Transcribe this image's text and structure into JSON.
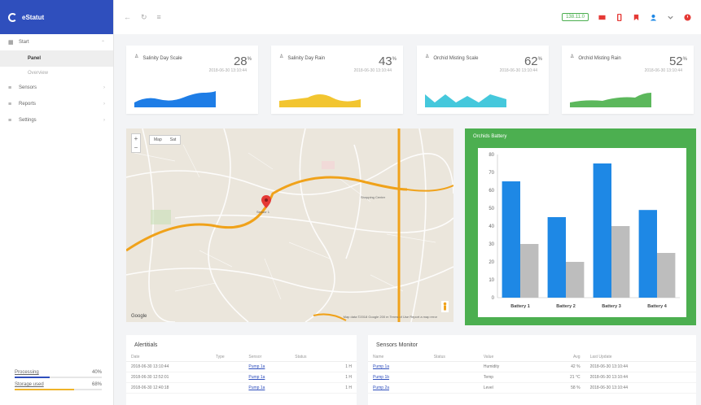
{
  "app": {
    "name": "eStatut"
  },
  "sidebar": {
    "items": [
      {
        "label": "Start",
        "icon": "grid-icon"
      },
      {
        "label": "Panel",
        "active": true
      },
      {
        "label": "Overview",
        "sub": true
      },
      {
        "label": "Sensors",
        "icon": "list-icon"
      },
      {
        "label": "Reports",
        "icon": "list-icon"
      },
      {
        "label": "Settings",
        "icon": "list-icon"
      }
    ],
    "stats": [
      {
        "label": "Processing",
        "value": "40%",
        "fraction": 0.4,
        "color": "#2f4fbd"
      },
      {
        "label": "Storage used",
        "value": "68%",
        "fraction": 0.68,
        "color": "#f0b429"
      }
    ]
  },
  "topbar": {
    "back": "←",
    "refresh": "↻",
    "menu": "≡",
    "badge": "138.11.0",
    "icons": [
      "mail-icon",
      "phone-icon",
      "bookmark-icon",
      "user-icon",
      "chevron-down-icon",
      "power-icon"
    ],
    "colors": {
      "accent": "#2f4fbd",
      "red": "#e53935"
    }
  },
  "kpis": [
    {
      "title": "Salinity Day Scale",
      "value": "28",
      "unit": "%",
      "sub": "2018-06-30 13:10:44",
      "color": "#1e7de6"
    },
    {
      "title": "Salinity Day Rain",
      "value": "43",
      "unit": "%",
      "sub": "2018-06-30 13:10:44",
      "color": "#f2c530"
    },
    {
      "title": "Orchid Misting Scale",
      "value": "62",
      "unit": "%",
      "sub": "2018-06-30 13:10:44",
      "color": "#45c8dc"
    },
    {
      "title": "Orchid Misting Rain",
      "value": "52",
      "unit": "%",
      "sub": "2018-06-30 13:10:44",
      "color": "#5cb85c"
    }
  ],
  "map": {
    "zoom_in": "+",
    "zoom_out": "−",
    "type_options": [
      "Map",
      "Sat"
    ],
    "credit": "Google",
    "legal": "Map data ©2018 Google  200 m  Terms of Use  Report a map error",
    "marker_label": "Sensor 1",
    "place_label": "Shopping Center"
  },
  "chart_panel": {
    "title": "Orchids Battery"
  },
  "chart_data": {
    "type": "bar",
    "categories": [
      "Battery 1",
      "Battery 2",
      "Battery 3",
      "Battery 4"
    ],
    "series": [
      {
        "values": [
          65,
          45,
          75,
          49
        ],
        "color": "#1e88e5"
      },
      {
        "values": [
          30,
          20,
          40,
          25
        ],
        "color": "#bdbdbd"
      }
    ],
    "ylim": [
      0,
      80
    ],
    "yticks": [
      0,
      10,
      20,
      30,
      40,
      50,
      60,
      70,
      80
    ],
    "grid": false
  },
  "alerts": {
    "title": "Alertitials",
    "columns": [
      "Date",
      "Type",
      "Sensor",
      "Status",
      ""
    ],
    "rows": [
      [
        "2018-06-30 13:10:44",
        "",
        "Pump 1a",
        "",
        "1 H"
      ],
      [
        "2018-06-30 12:52:01",
        "",
        "Pump 1a",
        "",
        "1 H"
      ],
      [
        "2018-06-30 12:40:18",
        "",
        "Pump 1a",
        "",
        "1 H"
      ]
    ]
  },
  "sensors": {
    "title": "Sensors Monitor",
    "columns": [
      "Name",
      "Status",
      "Value",
      "Avg",
      "Last Update"
    ],
    "rows": [
      [
        "Pump 1a",
        "",
        "Humidity",
        "42 %",
        "2018-06-30 13:10:44"
      ],
      [
        "Pump 1b",
        "",
        "Temp",
        "21 °C",
        "2018-06-30 13:10:44"
      ],
      [
        "Pump 2a",
        "",
        "Level",
        "58 %",
        "2018-06-30 13:10:44"
      ]
    ]
  }
}
